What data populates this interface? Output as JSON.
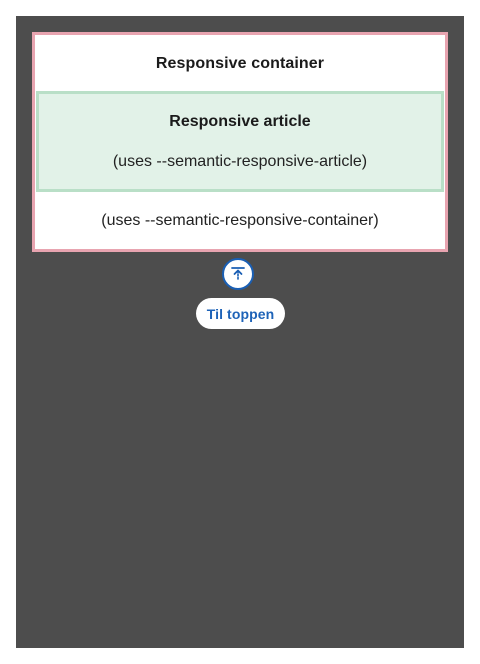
{
  "container": {
    "title": "Responsive container",
    "note": "(uses --semantic-responsive-container)"
  },
  "article": {
    "title": "Responsive article",
    "note": "(uses --semantic-responsive-article)"
  },
  "to_top": {
    "label": "Til toppen",
    "icon": "arrow-to-top-icon"
  },
  "colors": {
    "background": "#4d4d4d",
    "container_border": "#e8a4b0",
    "article_background": "#e2f2e8",
    "article_border": "#b9dfc7",
    "accent": "#1e63b8"
  }
}
